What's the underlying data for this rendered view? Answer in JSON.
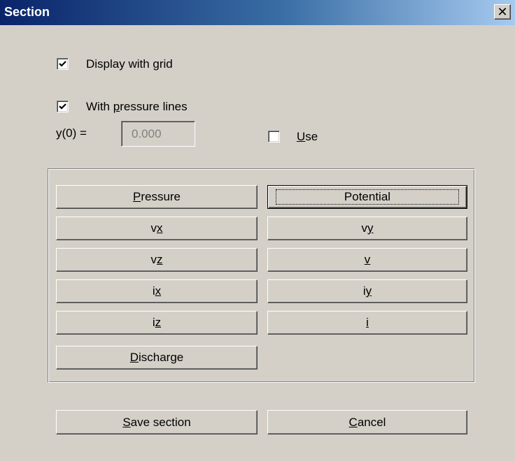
{
  "window": {
    "title": "Section",
    "close_glyph": "✕"
  },
  "options": {
    "display_grid": {
      "label": "Display with grid",
      "checked": true
    },
    "pressure_lines": {
      "label_pre": "With ",
      "label_accel": "p",
      "label_post": "ressure lines",
      "checked": true
    },
    "y0": {
      "label": "y(0) =",
      "value": "0.000",
      "disabled": true
    },
    "use": {
      "label_accel": "U",
      "label_post": "se",
      "checked": false
    }
  },
  "buttons": {
    "pressure": {
      "accel": "P",
      "rest": "ressure"
    },
    "potential": {
      "label": "Potential"
    },
    "vx": {
      "pre": "v",
      "accel": "x",
      "post": ""
    },
    "vy": {
      "pre": "v",
      "accel": "y",
      "post": ""
    },
    "vz": {
      "pre": "v",
      "accel": "z",
      "post": ""
    },
    "v": {
      "pre": "",
      "accel": "v",
      "post": ""
    },
    "ix": {
      "pre": "i",
      "accel": "x",
      "post": ""
    },
    "iy": {
      "pre": "i",
      "accel": "y",
      "post": ""
    },
    "iz": {
      "pre": "i",
      "accel": "z",
      "post": ""
    },
    "i": {
      "pre": "",
      "accel": "i",
      "post": ""
    },
    "discharge": {
      "accel": "D",
      "rest": "ischarge"
    },
    "save_section": {
      "accel": "S",
      "rest": "ave section"
    },
    "cancel": {
      "accel": "C",
      "rest": "ancel"
    }
  },
  "colors": {
    "face": "#d4d0c8",
    "title_start": "#0a246a",
    "title_end": "#a6caf0"
  }
}
